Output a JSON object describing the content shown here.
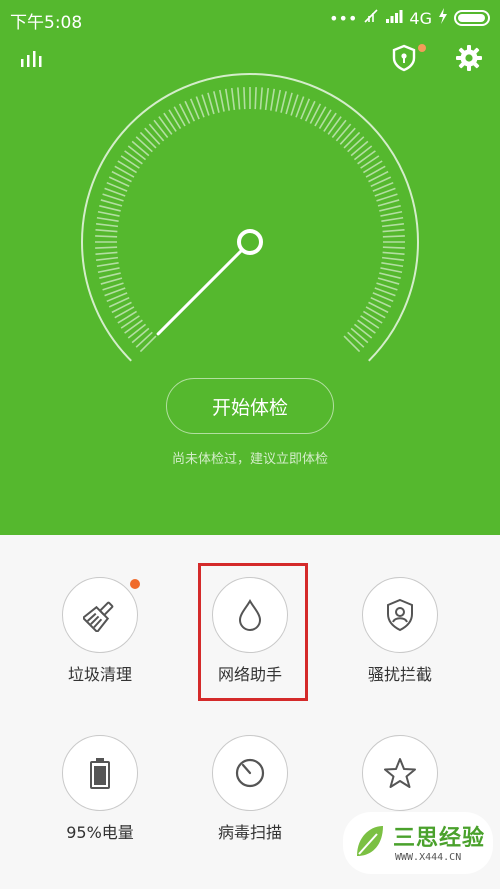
{
  "status_bar": {
    "time": "下午5:08",
    "network": "4G",
    "icons": [
      "dots-icon",
      "signal-off-icon",
      "signal-icon",
      "charging-icon",
      "battery-icon"
    ]
  },
  "header": {
    "icons": [
      "stats-icon",
      "shield-lock-icon",
      "gear-icon"
    ]
  },
  "gauge": {
    "needle_level": 0.0
  },
  "main": {
    "start_button": "开始体检",
    "hint": "尚未体检过，建议立即体检"
  },
  "tools": [
    {
      "label": "垃圾清理",
      "icon": "broom-icon",
      "badge": true
    },
    {
      "label": "网络助手",
      "icon": "drop-icon",
      "highlighted": true
    },
    {
      "label": "骚扰拦截",
      "icon": "shield-user-icon"
    },
    {
      "label": "95%电量",
      "icon": "battery-outline-icon"
    },
    {
      "label": "病毒扫描",
      "icon": "scan-icon"
    },
    {
      "label": "",
      "icon": "star-icon"
    }
  ],
  "watermark": {
    "title": "三思经验",
    "url": "WWW.X444.CN"
  },
  "colors": {
    "primary_green": "#55b82e",
    "badge_orange": "#f06a2a",
    "highlight_red": "#d42a2a"
  }
}
